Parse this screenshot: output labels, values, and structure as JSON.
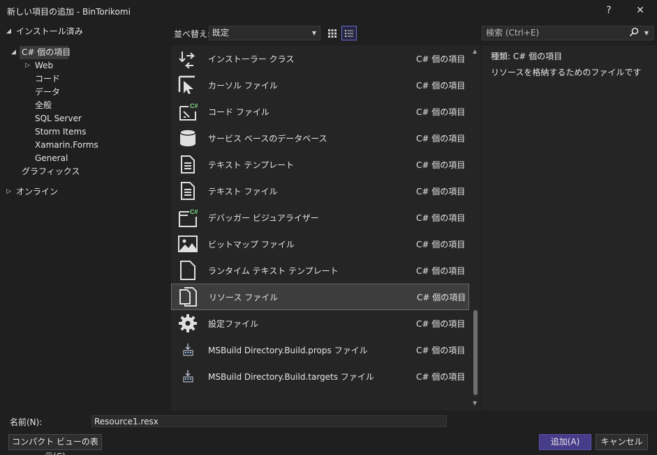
{
  "window": {
    "title": "新しい項目の追加 - BinTorikomi",
    "help_label": "?",
    "close_label": "✕"
  },
  "tree": {
    "installed": "インストール済み",
    "csharp": "C# 個の項目",
    "web": "Web",
    "code": "コード",
    "data": "データ",
    "all": "全般",
    "sql": "SQL Server",
    "storm": "Storm Items",
    "xamarin": "Xamarin.Forms",
    "general": "General",
    "graphics": "グラフィックス",
    "online": "オンライン"
  },
  "toolbar": {
    "sort_label": "並べ替え:",
    "sort_value": "既定"
  },
  "search": {
    "placeholder": "検索 (Ctrl+E)"
  },
  "items": [
    {
      "name": "インストーラー クラス",
      "lang": "C# 個の項目",
      "icon": "installer-class-icon"
    },
    {
      "name": "カーソル ファイル",
      "lang": "C# 個の項目",
      "icon": "cursor-file-icon"
    },
    {
      "name": "コード ファイル",
      "lang": "C# 個の項目",
      "icon": "code-file-icon"
    },
    {
      "name": "サービス ベースのデータベース",
      "lang": "C# 個の項目",
      "icon": "database-icon"
    },
    {
      "name": "テキスト テンプレート",
      "lang": "C# 個の項目",
      "icon": "text-template-icon"
    },
    {
      "name": "テキスト ファイル",
      "lang": "C# 個の項目",
      "icon": "text-file-icon"
    },
    {
      "name": "デバッガー ビジュアライザー",
      "lang": "C# 個の項目",
      "icon": "debugger-visualizer-icon"
    },
    {
      "name": "ビットマップ ファイル",
      "lang": "C# 個の項目",
      "icon": "bitmap-file-icon"
    },
    {
      "name": "ランタイム テキスト テンプレート",
      "lang": "C# 個の項目",
      "icon": "blank-file-icon"
    },
    {
      "name": "リソース ファイル",
      "lang": "C# 個の項目",
      "icon": "resource-file-icon"
    },
    {
      "name": "設定ファイル",
      "lang": "C# 個の項目",
      "icon": "settings-gear-icon"
    },
    {
      "name": "MSBuild Directory.Build.props ファイル",
      "lang": "C# 個の項目",
      "icon": "msbuild-icon"
    },
    {
      "name": "MSBuild Directory.Build.targets ファイル",
      "lang": "C# 個の項目",
      "icon": "msbuild-icon"
    }
  ],
  "details": {
    "kind_label": "種類:",
    "kind_value": "C# 個の項目",
    "description": "リソースを格納するためのファイルです"
  },
  "bottom": {
    "name_label": "名前(N):",
    "name_value": "Resource1.resx",
    "compact_button": "コンパクト ビューの表示(C)",
    "add_button": "追加(A)",
    "cancel_button": "キャンセル"
  }
}
